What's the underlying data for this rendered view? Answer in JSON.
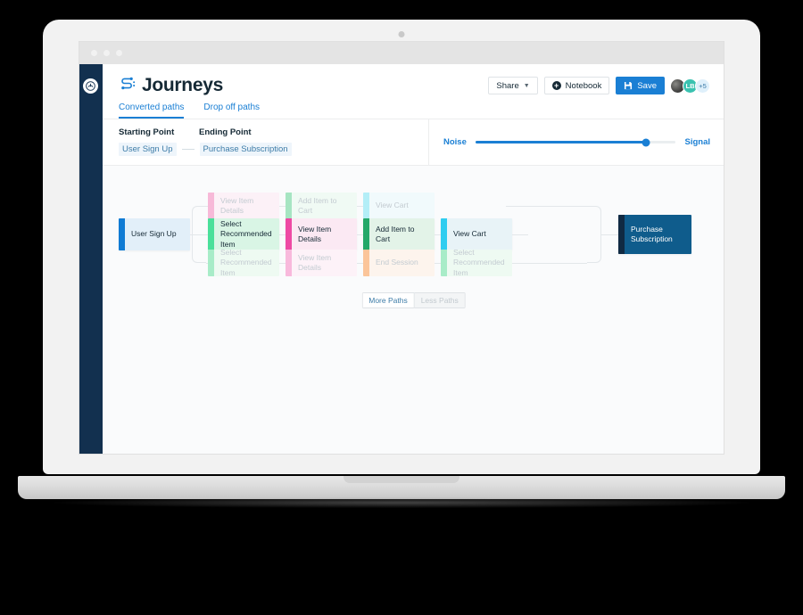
{
  "app": {
    "title": "Journeys",
    "logo_icon": "journeys-s-path-icon",
    "rail_icon": "app-logo-icon"
  },
  "toolbar": {
    "share_label": "Share",
    "share_caret": "⌄",
    "notebook_label": "Notebook",
    "notebook_icon": "plus-circle-icon",
    "save_label": "Save",
    "save_icon": "floppy-disk-icon",
    "avatars": [
      {
        "name": "user-photo",
        "initials": ""
      },
      {
        "name": "user-lb",
        "initials": "LB"
      },
      {
        "name": "overflow-count",
        "initials": "+5"
      }
    ]
  },
  "tabs": [
    {
      "label": "Converted paths",
      "active": true
    },
    {
      "label": "Drop off paths",
      "active": false
    }
  ],
  "filters": {
    "starting_point_label": "Starting Point",
    "ending_point_label": "Ending Point",
    "starting_point_value": "User Sign Up",
    "ending_point_value": "Purchase Subscription"
  },
  "slider": {
    "left_label": "Noise",
    "right_label": "Signal",
    "value_percent": 85
  },
  "canvas": {
    "start_node": {
      "label": "User Sign Up",
      "bar_color": "#0f7bd4",
      "body_color": "#e2eff9",
      "text_color": "#152935"
    },
    "end_node": {
      "label": "Purchase Subscription",
      "bar_color": "#102a43",
      "body_color": "#0f5c8c",
      "text_color": "#ffffff"
    },
    "rows": [
      {
        "name": "top-row",
        "nodes": [
          {
            "label": "View Item Details",
            "bar_color": "#f7b9d8",
            "body_color": "#fcf1f7",
            "text_color": "#c3cbd1"
          },
          {
            "label": "Add Item to Cart",
            "bar_color": "#a6e5c2",
            "body_color": "#f0faf4",
            "text_color": "#c3cbd1"
          },
          {
            "label": "View Cart",
            "bar_color": "#b3eef7",
            "body_color": "#f1fafc",
            "text_color": "#c3cbd1"
          }
        ]
      },
      {
        "name": "middle-row",
        "nodes": [
          {
            "label": "Select Recommended Item",
            "bar_color": "#4ae09a",
            "body_color": "#d9f5e5",
            "text_color": "#152935"
          },
          {
            "label": "View Item Details",
            "bar_color": "#ee49a4",
            "body_color": "#fbe9f3",
            "text_color": "#152935"
          },
          {
            "label": "Add Item to Cart",
            "bar_color": "#24a869",
            "body_color": "#e3f3e8",
            "text_color": "#152935"
          },
          {
            "label": "View Cart",
            "bar_color": "#2fcdf0",
            "body_color": "#e8f3f7",
            "text_color": "#152935"
          }
        ]
      },
      {
        "name": "bottom-row",
        "nodes": [
          {
            "label": "Select Recommended Item",
            "bar_color": "#a8ecc8",
            "body_color": "#eefaf2",
            "text_color": "#c3cbd1"
          },
          {
            "label": "View Item Details",
            "bar_color": "#f8b9dc",
            "body_color": "#fdf2f8",
            "text_color": "#c3cbd1"
          },
          {
            "label": "End Session",
            "bar_color": "#fbc59a",
            "body_color": "#fdf4ed",
            "text_color": "#c3cbd1"
          },
          {
            "label": "Select Recommended Item",
            "bar_color": "#a8ecc8",
            "body_color": "#eefaf2",
            "text_color": "#c3cbd1"
          }
        ]
      }
    ],
    "more_paths_label": "More Paths",
    "less_paths_label": "Less Paths"
  },
  "colors": {
    "accent": "#1a7fd4",
    "rail": "#12304f",
    "text": "#152935"
  }
}
